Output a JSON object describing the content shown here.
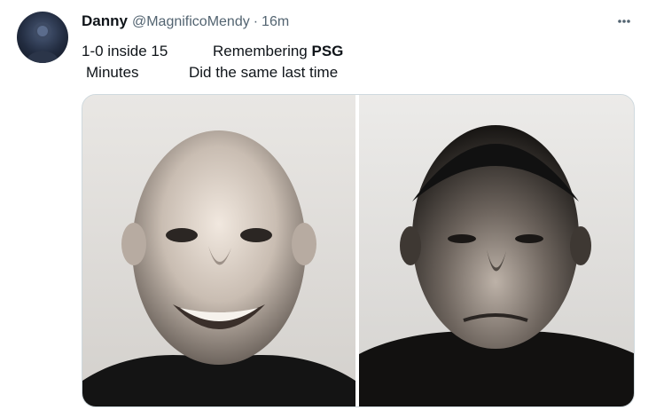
{
  "tweet": {
    "display_name": "Danny",
    "handle": "@MagnificoMendy",
    "separator": "·",
    "time": "16m",
    "more_icon": "more-horizontal-icon",
    "text": {
      "line1_left": "1-0 inside 15",
      "line1_right_prefix": "Remembering ",
      "line1_right_bold": "PSG",
      "line2_left": "Minutes",
      "line2_right": "Did the same last time"
    }
  },
  "colors": {
    "text_primary": "#0f1419",
    "text_secondary": "#536471",
    "border": "#cfd9de"
  }
}
